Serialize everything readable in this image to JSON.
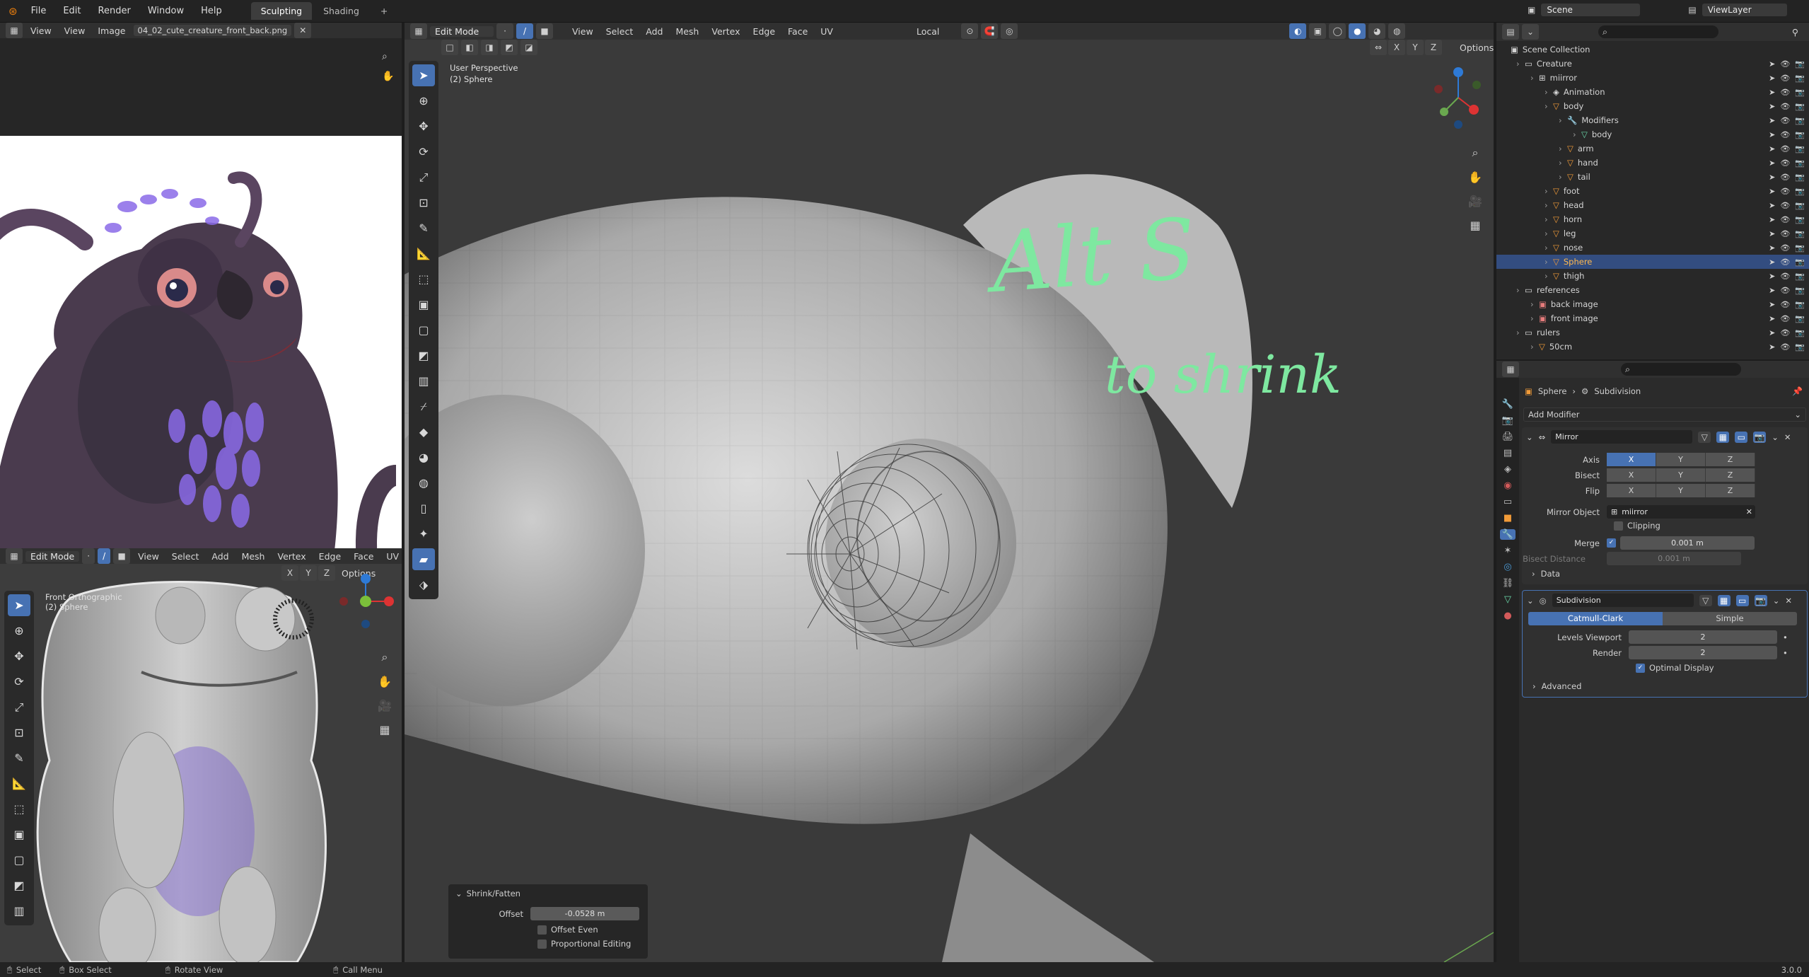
{
  "topbar": {
    "menus": [
      "File",
      "Edit",
      "Render",
      "Window",
      "Help"
    ],
    "workspaces": [
      "Sculpting",
      "Shading"
    ],
    "add": "+",
    "scene": "Scene",
    "view_layer": "ViewLayer"
  },
  "image_editor": {
    "view": "View",
    "menu": [
      "View",
      "Image"
    ],
    "image_name": "04_02_cute_creature_front_back.png"
  },
  "front_viewport": {
    "mode": "Edit Mode",
    "menu": [
      "View",
      "Select",
      "Add",
      "Mesh",
      "Vertex",
      "Edge",
      "Face",
      "UV"
    ],
    "axes": [
      "X",
      "Y",
      "Z"
    ],
    "options": "Options",
    "view_name": "Front Orthographic",
    "object_name": "(2) Sphere"
  },
  "main_viewport": {
    "mode": "Edit Mode",
    "menu": [
      "View",
      "Select",
      "Add",
      "Mesh",
      "Vertex",
      "Edge",
      "Face",
      "UV"
    ],
    "orientation": "Local",
    "axes": [
      "X",
      "Y",
      "Z"
    ],
    "options": "Options",
    "view_name": "User Perspective",
    "object_name": "(2) Sphere",
    "annotation_1": "Alt S",
    "annotation_2": "to shrink",
    "annotation_color": "#7ee8a0"
  },
  "operator_panel": {
    "title": "Shrink/Fatten",
    "offset_label": "Offset",
    "offset_value": "-0.0528 m",
    "offset_even": "Offset Even",
    "proportional": "Proportional Editing"
  },
  "outliner": {
    "root": "Scene Collection",
    "items": [
      {
        "name": "Creature",
        "depth": 0,
        "type": "collection"
      },
      {
        "name": "miirror",
        "depth": 1,
        "type": "empty"
      },
      {
        "name": "Animation",
        "depth": 2,
        "type": "anim"
      },
      {
        "name": "body",
        "depth": 2,
        "type": "mesh"
      },
      {
        "name": "Modifiers",
        "depth": 3,
        "type": "mod"
      },
      {
        "name": "body",
        "depth": 4,
        "type": "data"
      },
      {
        "name": "arm",
        "depth": 3,
        "type": "mesh"
      },
      {
        "name": "hand",
        "depth": 3,
        "type": "mesh"
      },
      {
        "name": "tail",
        "depth": 3,
        "type": "mesh"
      },
      {
        "name": "foot",
        "depth": 2,
        "type": "mesh"
      },
      {
        "name": "head",
        "depth": 2,
        "type": "mesh"
      },
      {
        "name": "horn",
        "depth": 2,
        "type": "mesh"
      },
      {
        "name": "leg",
        "depth": 2,
        "type": "mesh"
      },
      {
        "name": "nose",
        "depth": 2,
        "type": "mesh"
      },
      {
        "name": "Sphere",
        "depth": 2,
        "type": "mesh",
        "selected": true
      },
      {
        "name": "thigh",
        "depth": 2,
        "type": "mesh"
      },
      {
        "name": "references",
        "depth": 0,
        "type": "collection"
      },
      {
        "name": "back image",
        "depth": 1,
        "type": "image"
      },
      {
        "name": "front image",
        "depth": 1,
        "type": "image"
      },
      {
        "name": "rulers",
        "depth": 0,
        "type": "collection"
      },
      {
        "name": "50cm",
        "depth": 1,
        "type": "mesh"
      }
    ]
  },
  "properties": {
    "breadcrumb_object": "Sphere",
    "breadcrumb_modifier": "Subdivision",
    "add_modifier": "Add Modifier",
    "mirror": {
      "name": "Mirror",
      "axis_label": "Axis",
      "bisect_label": "Bisect",
      "flip_label": "Flip",
      "axes": [
        "X",
        "Y",
        "Z"
      ],
      "mirror_object_label": "Mirror Object",
      "mirror_object": "miirror",
      "clipping": "Clipping",
      "merge_label": "Merge",
      "merge_value": "0.001 m",
      "bisect_distance_label": "Bisect Distance",
      "bisect_distance_value": "0.001 m",
      "data": "Data"
    },
    "subdivision": {
      "name": "Subdivision",
      "catmull": "Catmull-Clark",
      "simple": "Simple",
      "levels_label": "Levels Viewport",
      "levels_value": "2",
      "render_label": "Render",
      "render_value": "2",
      "optimal": "Optimal Display",
      "advanced": "Advanced"
    }
  },
  "statusbar": {
    "select": "Select",
    "box_select": "Box Select",
    "rotate": "Rotate View",
    "call_menu": "Call Menu",
    "version": "3.0.0"
  }
}
